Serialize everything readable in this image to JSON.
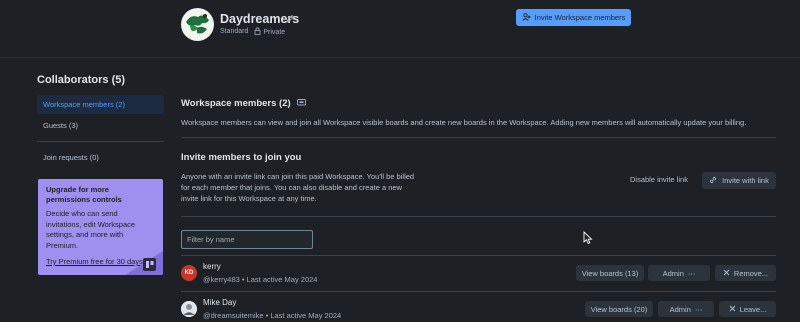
{
  "header": {
    "workspace_name": "Daydreamers",
    "visibility_standard": "Standard",
    "visibility_private": "Private",
    "invite_button": "Invite Workspace members"
  },
  "sidebar": {
    "title": "Collaborators (5)",
    "items": [
      {
        "label": "Workspace members (2)"
      },
      {
        "label": "Guests (3)"
      },
      {
        "label": "Join requests (0)"
      }
    ],
    "promo": {
      "title": "Upgrade for more permissions controls",
      "text": "Decide who can send invitations, edit Workspace settings, and more with Premium.",
      "link": "Try Premium free for 30 days"
    }
  },
  "main": {
    "title": "Workspace members (2)",
    "description": "Workspace members can view and join all Workspace visible boards and create new boards in the Workspace. Adding new members will automatically update your billing.",
    "invite_title": "Invite members to join you",
    "invite_text": "Anyone with an invite link can join this paid Workspace. You'll be billed for each member that joins. You can also disable and create a new invite link for this Workspace at any time.",
    "disable_link": "Disable invite link",
    "invite_with_link": "Invite with link",
    "filter_placeholder": "Filter by name",
    "members": [
      {
        "initials": "KD",
        "name": "kerry",
        "handle": "@kerry483 • Last active May 2024",
        "view_boards": "View boards (13)",
        "role": "Admin",
        "action": "Remove..."
      },
      {
        "initials": "",
        "name": "Mike Day",
        "handle": "@dreamsuitemike • Last active May 2024",
        "view_boards": "View boards (20)",
        "role": "Admin",
        "action": "Leave..."
      }
    ]
  },
  "colors": {
    "background": "#1d2125",
    "accent": "#579dff",
    "promo": "#9f8fef"
  }
}
